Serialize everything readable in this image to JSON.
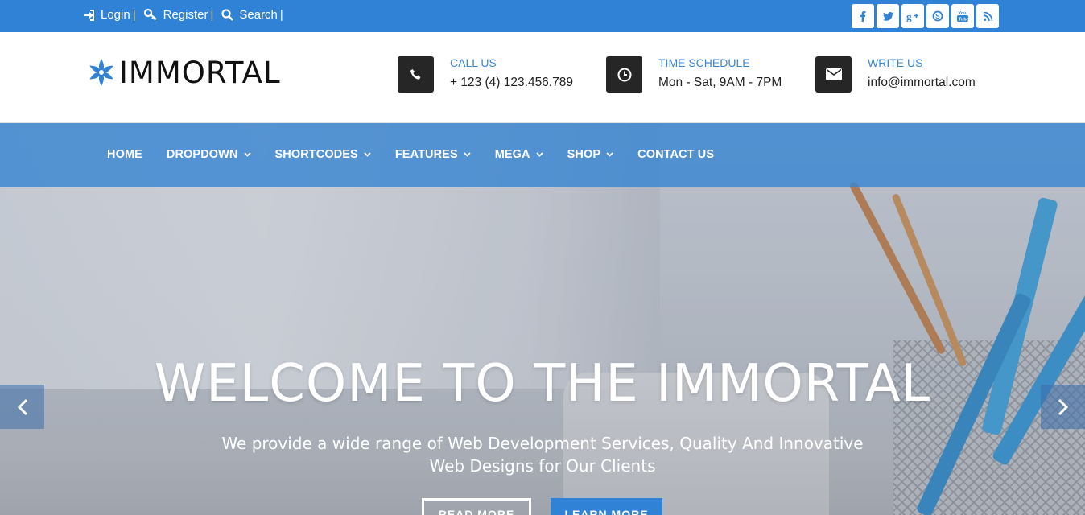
{
  "topbar": {
    "links": [
      {
        "label": "Login",
        "icon": "sign-in-icon"
      },
      {
        "label": "Register",
        "icon": "key-icon"
      },
      {
        "label": "Search",
        "icon": "search-icon"
      }
    ],
    "separator": "|",
    "social": [
      {
        "name": "facebook",
        "glyph": "f"
      },
      {
        "name": "twitter",
        "glyph": "t"
      },
      {
        "name": "google-plus",
        "glyph": "g+"
      },
      {
        "name": "skype",
        "glyph": "S"
      },
      {
        "name": "youtube",
        "glyph": "You"
      },
      {
        "name": "rss",
        "glyph": "rss"
      }
    ]
  },
  "header": {
    "logo_text": "IMMORTAL",
    "info": [
      {
        "label": "CALL US",
        "value": "+ 123 (4) 123.456.789",
        "icon": "phone-icon"
      },
      {
        "label": "TIME SCHEDULE",
        "value": "Mon - Sat, 9AM - 7PM",
        "icon": "clock-icon"
      },
      {
        "label": "WRITE US",
        "value": "info@immortal.com",
        "icon": "envelope-icon"
      }
    ]
  },
  "nav": {
    "items": [
      {
        "label": "HOME",
        "dropdown": false
      },
      {
        "label": "DROPDOWN",
        "dropdown": true
      },
      {
        "label": "SHORTCODES",
        "dropdown": true
      },
      {
        "label": "FEATURES",
        "dropdown": true
      },
      {
        "label": "MEGA",
        "dropdown": true
      },
      {
        "label": "SHOP",
        "dropdown": true
      },
      {
        "label": "CONTACT US",
        "dropdown": false
      }
    ]
  },
  "hero": {
    "title": "WELCOME TO THE IMMORTAL",
    "subtitle": "We provide a wide range of Web Development Services, Quality And Innovative Web Designs for Our Clients",
    "read_more": "READ MORE",
    "learn_more": "LEARN MORE"
  },
  "colors": {
    "accent": "#2f82d6",
    "nav_overlay": "#3a86d2",
    "dark_icon_bg": "#262626",
    "info_label": "#3b87d4"
  }
}
